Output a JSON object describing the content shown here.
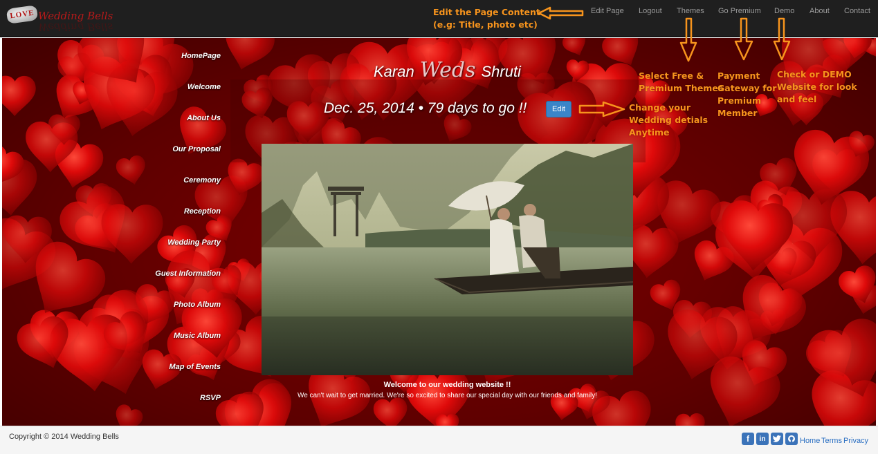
{
  "brand": {
    "badge": "LOVE",
    "name": "Wedding Bells"
  },
  "nav": {
    "edit_page": "Edit Page",
    "logout": "Logout",
    "themes": "Themes",
    "go_premium": "Go Premium",
    "demo": "Demo",
    "about": "About",
    "contact": "Contact"
  },
  "sidebar": {
    "items": [
      "HomePage",
      "Welcome",
      "About Us",
      "Our Proposal",
      "Ceremony",
      "Reception",
      "Wedding Party",
      "Guest Information",
      "Photo Album",
      "Music Album",
      "Map of Events",
      "RSVP"
    ]
  },
  "hero": {
    "groom": "Karan",
    "weds": "Weds",
    "bride": "Shruti",
    "date_line": "Dec. 25, 2014 • 79 days to go !!",
    "edit_button": "Edit",
    "welcome_title": "Welcome to our wedding website !!",
    "welcome_text": "We can't wait to get married. We're so excited to share our special day with our friends and family!"
  },
  "annotations": {
    "edit_content_1": "Edit the Page Content",
    "edit_content_2": "(e.g: Title, photo etc)",
    "themes_1": "Select Free &",
    "themes_2": "Premium Themes",
    "premium_1": "Payment",
    "premium_2": "Gateway for",
    "premium_3": "Premium",
    "premium_4": "Member",
    "demo_1": "Check or DEMO",
    "demo_2": "Website for look",
    "demo_3": "and feel",
    "details_1": "Change your",
    "details_2": "Wedding detials",
    "details_3": "Anytime"
  },
  "footer": {
    "copyright": "Copyright © 2014 Wedding Bells",
    "home": "Home",
    "terms": "Terms",
    "privacy": "Privacy",
    "social_icons": [
      "facebook-icon",
      "linkedin-icon",
      "twitter-icon",
      "github-icon"
    ]
  },
  "colors": {
    "navbar_bg": "#1f1f1f",
    "hero_red": "#c00000",
    "annotation_orange": "#f7941d",
    "edit_button_blue": "#3a85c8",
    "footer_link_blue": "#2a6fc2"
  }
}
